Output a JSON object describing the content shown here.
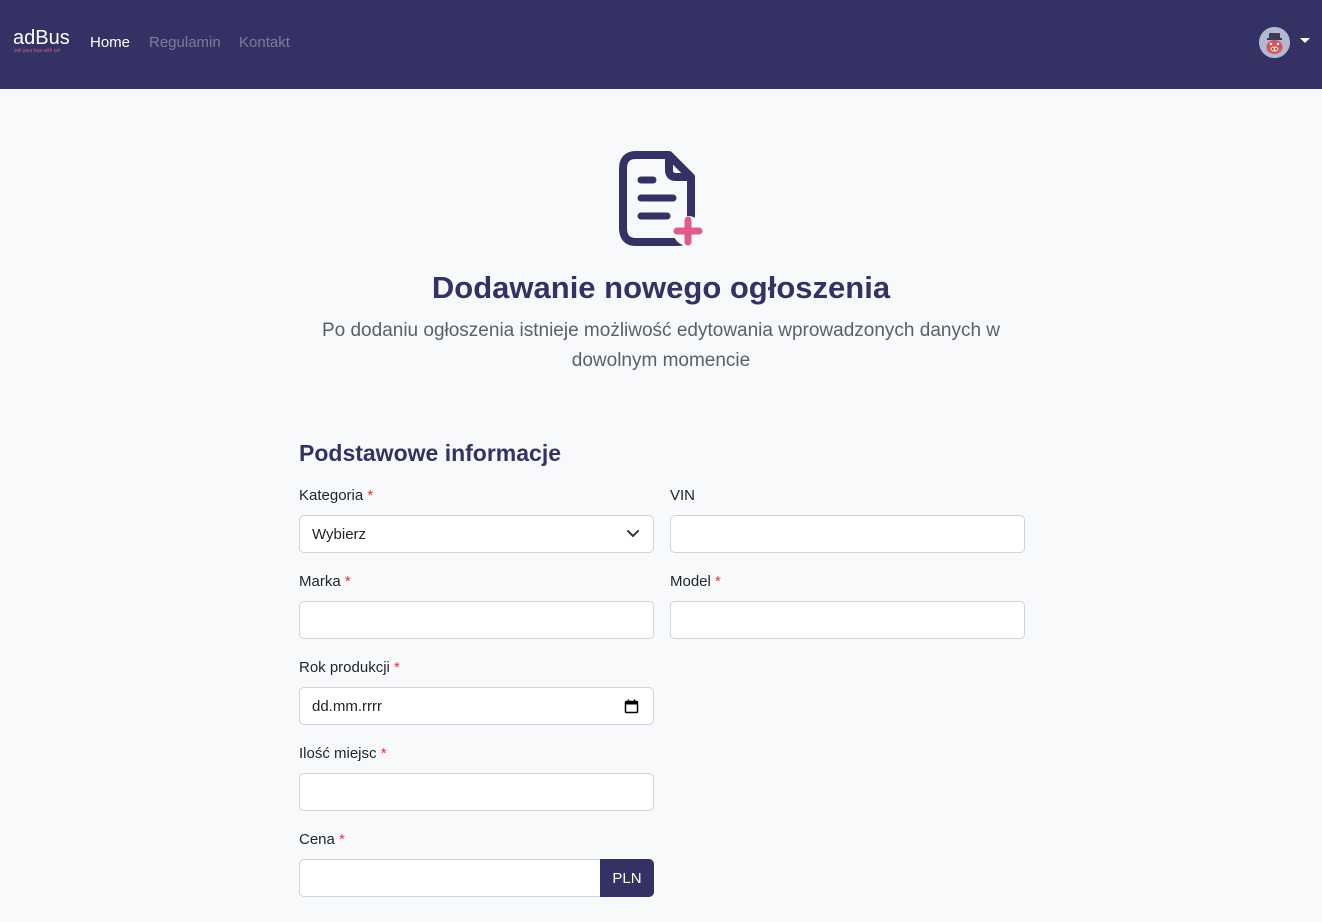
{
  "navbar": {
    "brand_name": "adBus",
    "brand_tagline": "sell your bus with us!",
    "links": [
      {
        "label": "Home",
        "active": true
      },
      {
        "label": "Regulamin",
        "active": false
      },
      {
        "label": "Kontakt",
        "active": false
      }
    ],
    "user_menu_icon": "avatar-icon"
  },
  "hero": {
    "icon": "document-add-icon",
    "title": "Dodawanie nowego ogłoszenia",
    "subtitle": "Po dodaniu ogłoszenia istnieje możliwość edytowania wprowadzonych danych w dowolnym momencie"
  },
  "form": {
    "section_title": "Podstawowe informacje",
    "required_marker": "*",
    "fields": {
      "kategoria": {
        "label": "Kategoria",
        "required": true,
        "value": "Wybierz"
      },
      "vin": {
        "label": "VIN",
        "required": false,
        "value": ""
      },
      "marka": {
        "label": "Marka",
        "required": true,
        "value": ""
      },
      "model": {
        "label": "Model",
        "required": true,
        "value": ""
      },
      "rok_produkcji": {
        "label": "Rok produkcji",
        "required": true,
        "placeholder": "dd.mm.rrrr"
      },
      "ilosc_miejsc": {
        "label": "Ilość miejsc",
        "required": true,
        "value": ""
      },
      "cena": {
        "label": "Cena",
        "required": true,
        "value": "",
        "currency": "PLN"
      }
    }
  },
  "colors": {
    "navbar": "#343264",
    "accent": "#e05a8c",
    "title": "#343264",
    "required": "#dc3545",
    "background": "#f8f9fb"
  }
}
